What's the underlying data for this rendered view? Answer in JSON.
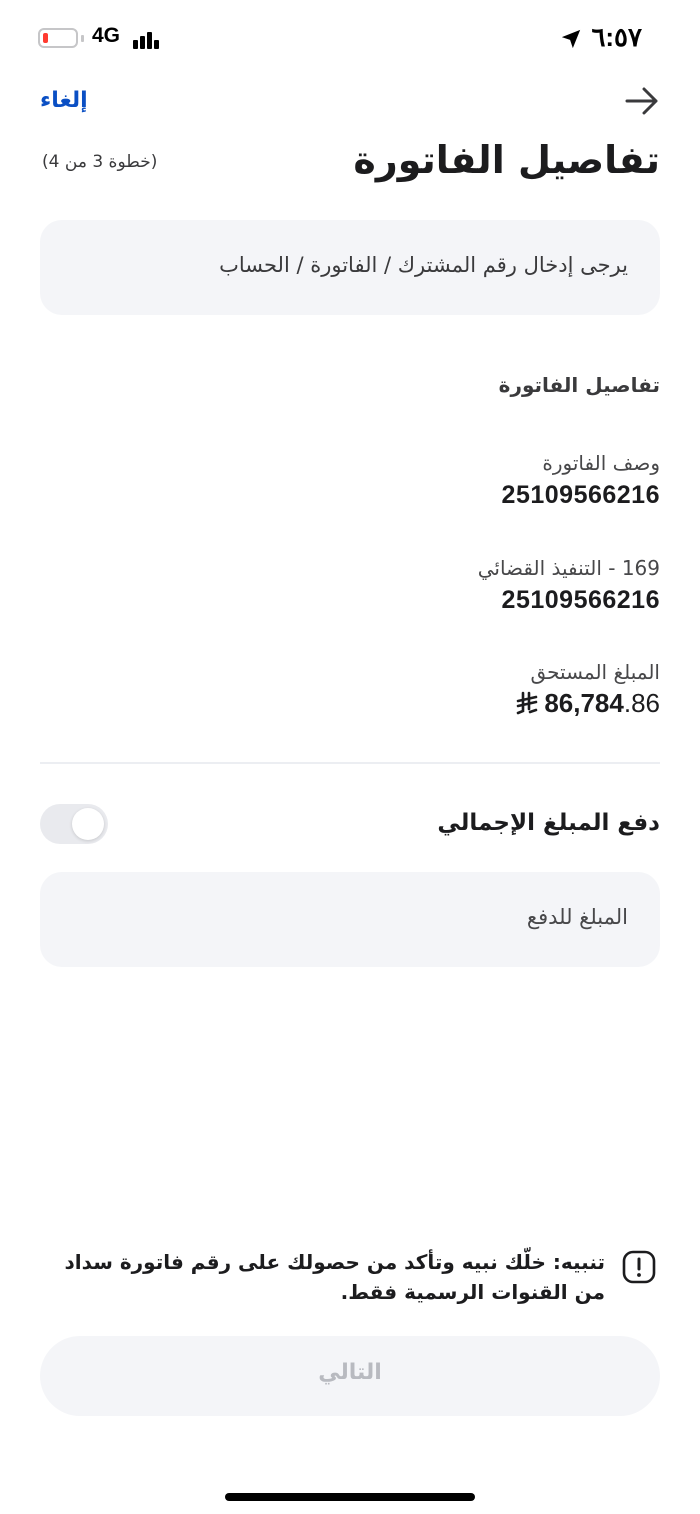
{
  "status_bar": {
    "time": "٦:٥٧",
    "network": "4G",
    "battery_level": 0.15,
    "battery_color": "#ff3b30"
  },
  "header": {
    "cancel_label": "إلغاء",
    "back_icon": "arrow-right-icon",
    "title": "تفاصيل الفاتورة",
    "step": "(خطوة 3 من 4)"
  },
  "subscriber_input": {
    "placeholder": "يرجى إدخال رقم المشترك / الفاتورة / الحساب"
  },
  "bill_details": {
    "section_title": "تفاصيل الفاتورة",
    "fields": [
      {
        "label": "وصف الفاتورة",
        "value": "25109566216"
      },
      {
        "label": "169 - التنفيذ القضائي",
        "value": "25109566216"
      }
    ],
    "amount_due": {
      "label": "المبلغ المستحق",
      "integer": "86,784",
      "decimal": ".86",
      "currency_icon": "saudi-riyal-icon"
    }
  },
  "pay_total": {
    "label": "دفع المبلغ الإجمالي",
    "enabled": false
  },
  "pay_amount_input": {
    "placeholder": "المبلغ للدفع"
  },
  "warning": {
    "icon": "exclamation-icon",
    "text": "تنبيه: خلّك نبيه وتأكد من حصولك على رقم فاتورة سداد من القنوات الرسمية فقط."
  },
  "next_button": {
    "label": "التالي",
    "disabled": true
  },
  "colors": {
    "accent": "#0a4fc4",
    "box_bg": "#f4f5f8",
    "disabled_text": "#b8bac0"
  }
}
